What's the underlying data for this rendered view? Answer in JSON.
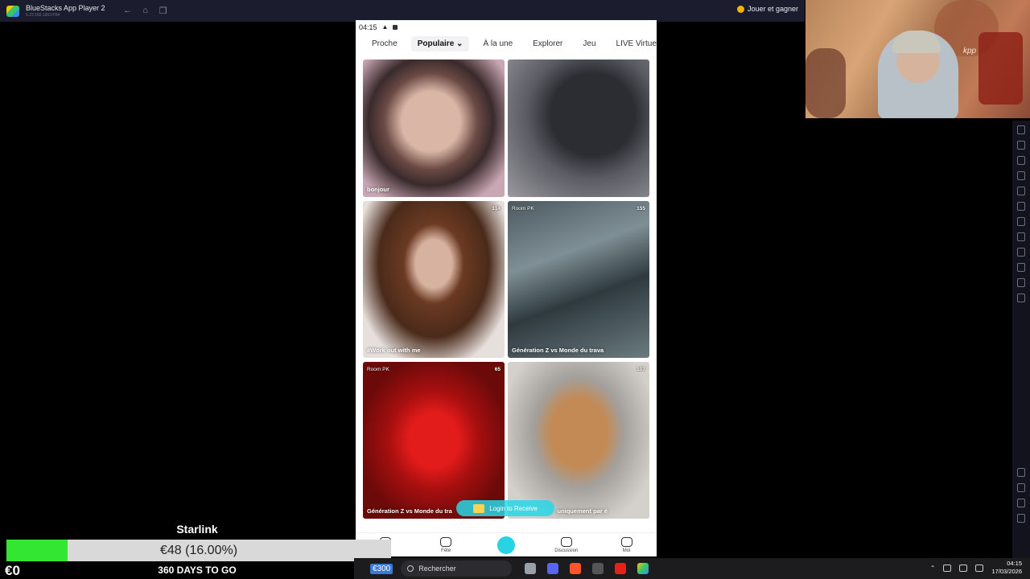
{
  "emulator": {
    "title": "BlueStacks App Player 2",
    "version": "5.22.166.1003  P64",
    "play_label": "Jouer et gagner"
  },
  "phone": {
    "status_time": "04:15",
    "tabs": [
      "Proche",
      "Populaire",
      "À la une",
      "Explorer",
      "Jeu",
      "LIVE Virtuel"
    ],
    "cards": [
      {
        "caption": "bonjour",
        "badge_left": "",
        "badge_right": ""
      },
      {
        "caption": "",
        "badge_left": "",
        "badge_right": ""
      },
      {
        "caption": "#Work out with me",
        "badge_left": "",
        "badge_right": "314"
      },
      {
        "caption": "Génération Z vs Monde du trava",
        "badge_left": "Room PK",
        "badge_right": "155"
      },
      {
        "caption": "Génération Z vs Monde du tra",
        "badge_left": "Room PK",
        "badge_right": "65"
      },
      {
        "caption": "uniquement par é",
        "badge_left": "",
        "badge_right": "107"
      }
    ],
    "login_pill": "Login to Receive",
    "bottom_nav": [
      "chir",
      "Fête",
      "",
      "Discussion",
      "Moi"
    ]
  },
  "overlay": {
    "goal_label": "Starlink",
    "progress_text": "€48 (16.00%)",
    "progress_fraction": 0.16,
    "money": "€0",
    "days": "360 DAYS TO GO"
  },
  "webcam": {
    "tag": "kpp"
  },
  "taskbar": {
    "badge": "€300",
    "search_placeholder": "Rechercher",
    "time": "04:15",
    "date": "17/03/2026"
  }
}
